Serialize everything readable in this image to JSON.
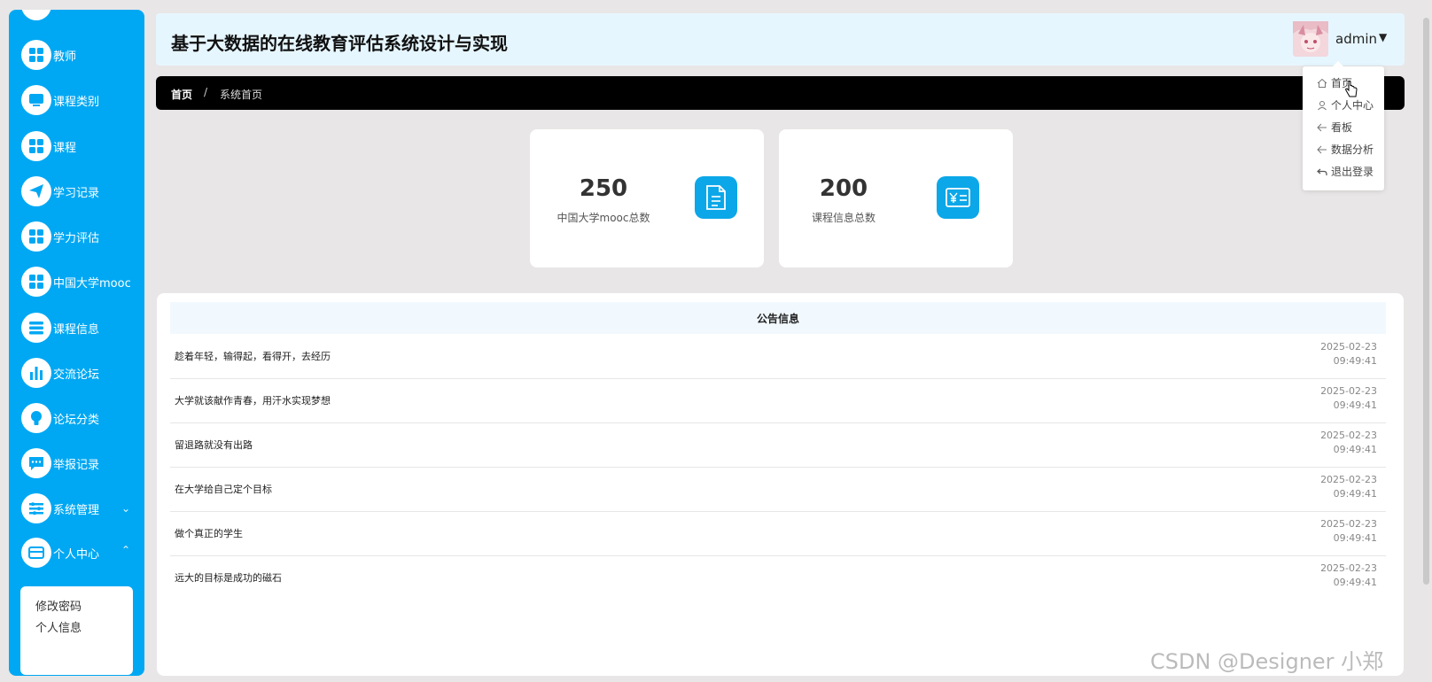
{
  "sidebar": {
    "items": [
      {
        "label": "教师",
        "icon": "grid-icon"
      },
      {
        "label": "课程类别",
        "icon": "monitor-icon"
      },
      {
        "label": "课程",
        "icon": "grid-icon"
      },
      {
        "label": "学习记录",
        "icon": "paper-plane-icon"
      },
      {
        "label": "学力评估",
        "icon": "grid-icon"
      },
      {
        "label": "中国大学mooc",
        "icon": "grid-icon"
      },
      {
        "label": "课程信息",
        "icon": "list-icon"
      },
      {
        "label": "交流论坛",
        "icon": "bar-chart-icon"
      },
      {
        "label": "论坛分类",
        "icon": "lightbulb-icon"
      },
      {
        "label": "举报记录",
        "icon": "chat-icon"
      },
      {
        "label": "系统管理",
        "icon": "settings-icon"
      },
      {
        "label": "个人中心",
        "icon": "card-icon"
      }
    ],
    "submenu": [
      "修改密码",
      "个人信息"
    ]
  },
  "header": {
    "title": "基于大数据的在线教育评估系统设计与实现",
    "username": "admin"
  },
  "breadcrumb": {
    "home": "首页",
    "separator": "/",
    "current": "系统首页"
  },
  "dropdown": {
    "items": [
      "首页",
      "个人中心",
      "看板",
      "数据分析",
      "退出登录"
    ]
  },
  "stats": [
    {
      "value": "250",
      "label": "中国大学mooc总数",
      "icon": "document-icon"
    },
    {
      "value": "200",
      "label": "课程信息总数",
      "icon": "yen-card-icon"
    }
  ],
  "notice": {
    "title": "公告信息",
    "items": [
      {
        "text": "趁着年轻，输得起，看得开，去经历",
        "date": "2025-02-23",
        "time": "09:49:41"
      },
      {
        "text": "大学就该献作青春，用汗水实现梦想",
        "date": "2025-02-23",
        "time": "09:49:41"
      },
      {
        "text": "留退路就没有出路",
        "date": "2025-02-23",
        "time": "09:49:41"
      },
      {
        "text": "在大学给自己定个目标",
        "date": "2025-02-23",
        "time": "09:49:41"
      },
      {
        "text": "做个真正的学生",
        "date": "2025-02-23",
        "time": "09:49:41"
      },
      {
        "text": "远大的目标是成功的磁石",
        "date": "2025-02-23",
        "time": "09:49:41"
      }
    ]
  },
  "watermark": "CSDN @Designer 小郑",
  "colors": {
    "sidebar_bg": "#00a8f3",
    "header_bg": "#e6f6ff",
    "breadcrumb_bg": "#000000",
    "icon_tile": "#0ca7e8",
    "page_bg": "#e8e6e6"
  }
}
